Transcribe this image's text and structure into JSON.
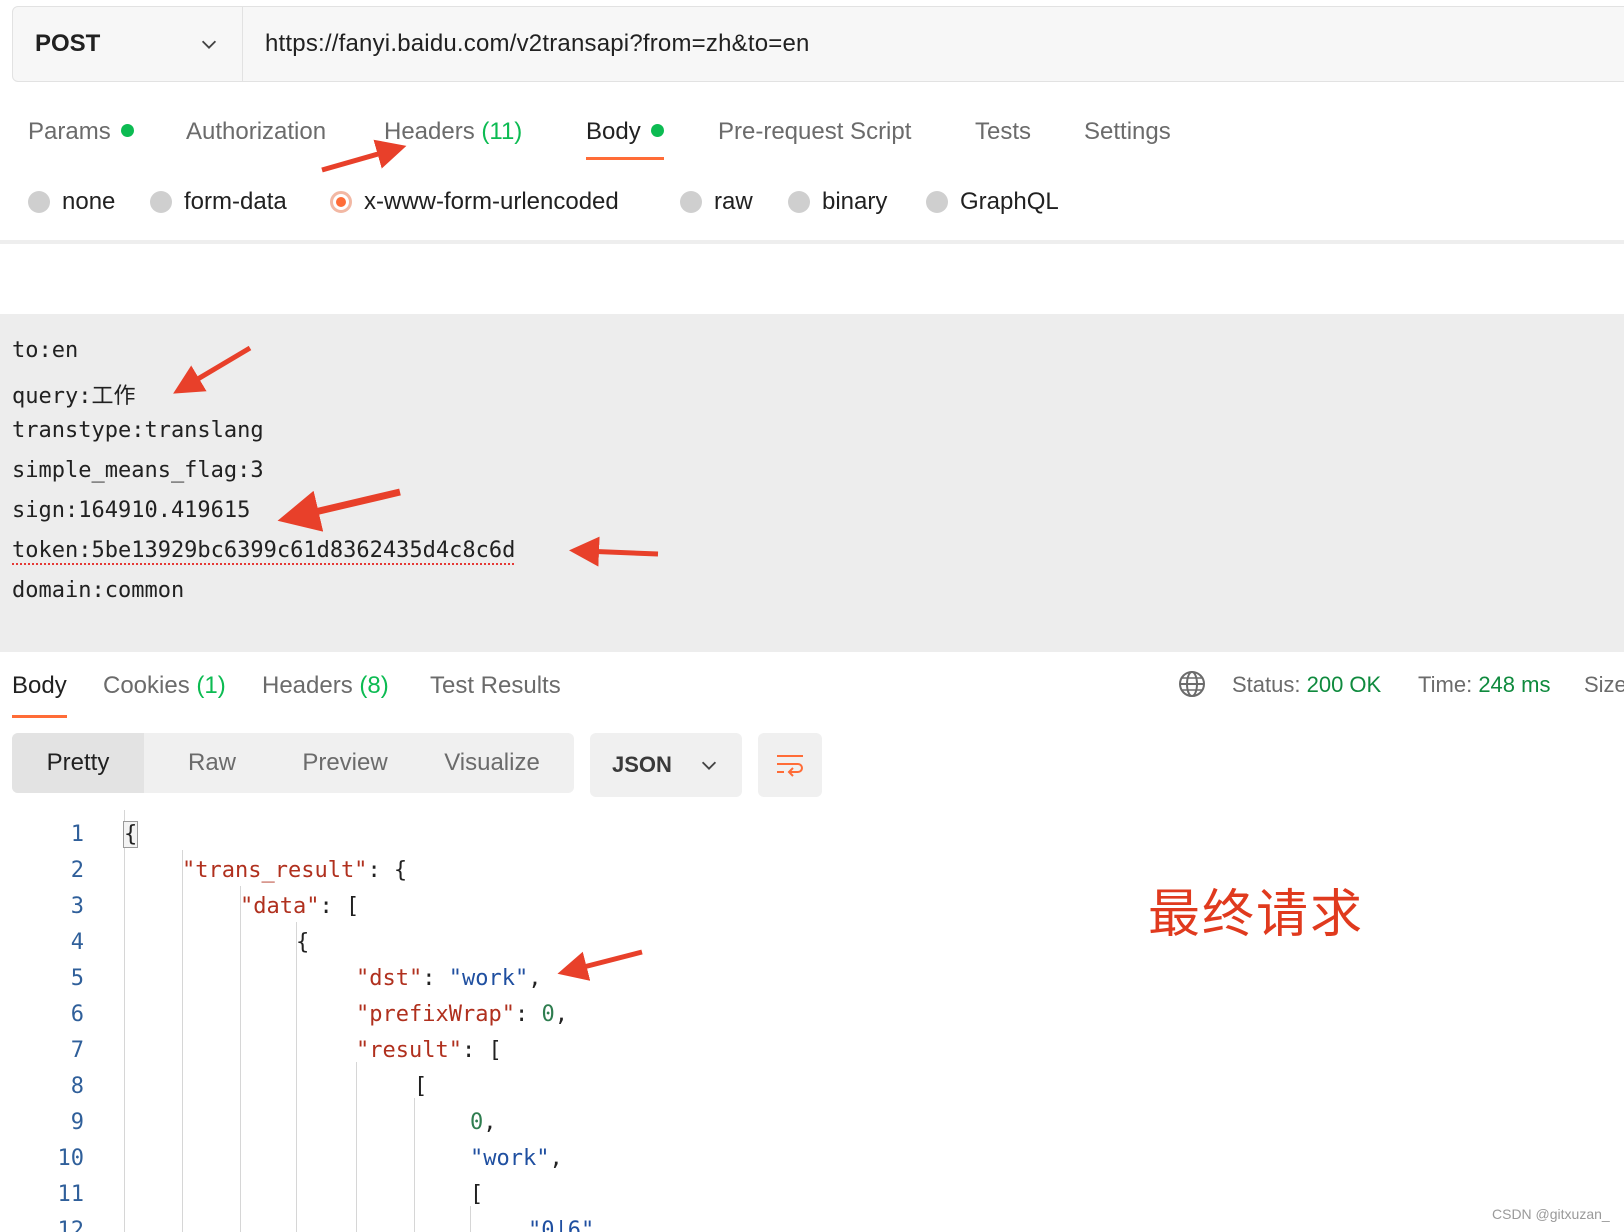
{
  "request": {
    "method": "POST",
    "url": "https://fanyi.baidu.com/v2transapi?from=zh&to=en"
  },
  "request_tabs": {
    "params": "Params",
    "authorization": "Authorization",
    "headers": "Headers",
    "headers_count": "(11)",
    "body": "Body",
    "prerequest": "Pre-request Script",
    "tests": "Tests",
    "settings": "Settings"
  },
  "body_types": {
    "none": "none",
    "form_data": "form-data",
    "urlencoded": "x-www-form-urlencoded",
    "raw": "raw",
    "binary": "binary",
    "graphql": "GraphQL",
    "selected": "x-www-form-urlencoded"
  },
  "params_text": [
    "to:en",
    "query:工作",
    "transtype:translang",
    "simple_means_flag:3",
    "sign:164910.419615",
    "token:5be13929bc6399c61d8362435d4c8c6d",
    "domain:common"
  ],
  "response_tabs": {
    "body": "Body",
    "cookies": "Cookies",
    "cookies_count": "(1)",
    "headers": "Headers",
    "headers_count": "(8)",
    "test_results": "Test Results"
  },
  "response_status": {
    "status_label": "Status:",
    "status_value": "200 OK",
    "time_label": "Time:",
    "time_value": "248 ms",
    "size_label": "Size"
  },
  "view_modes": {
    "pretty": "Pretty",
    "raw": "Raw",
    "preview": "Preview",
    "visualize": "Visualize",
    "format": "JSON"
  },
  "code": {
    "line_numbers": [
      "1",
      "2",
      "3",
      "4",
      "5",
      "6",
      "7",
      "8",
      "9",
      "10",
      "11",
      "12"
    ],
    "l1": "{",
    "l2_key": "\"trans_result\"",
    "l2_rest": ": {",
    "l3_key": "\"data\"",
    "l3_rest": ": [",
    "l4": "{",
    "l5_key": "\"dst\"",
    "l5_colon": ": ",
    "l5_val": "\"work\"",
    "l5_comma": ",",
    "l6_key": "\"prefixWrap\"",
    "l6_colon": ": ",
    "l6_val": "0",
    "l6_comma": ",",
    "l7_key": "\"result\"",
    "l7_rest": ": [",
    "l8": "[",
    "l9_val": "0",
    "l9_comma": ",",
    "l10_val": "\"work\"",
    "l10_comma": ",",
    "l11": "[",
    "l12_val": "\"0|6\""
  },
  "annotation": "最终请求",
  "watermark": "CSDN @gitxuzan_",
  "colors": {
    "accent": "#ff6c37",
    "success": "#0cbb52",
    "annotation": "#e03a1e"
  }
}
